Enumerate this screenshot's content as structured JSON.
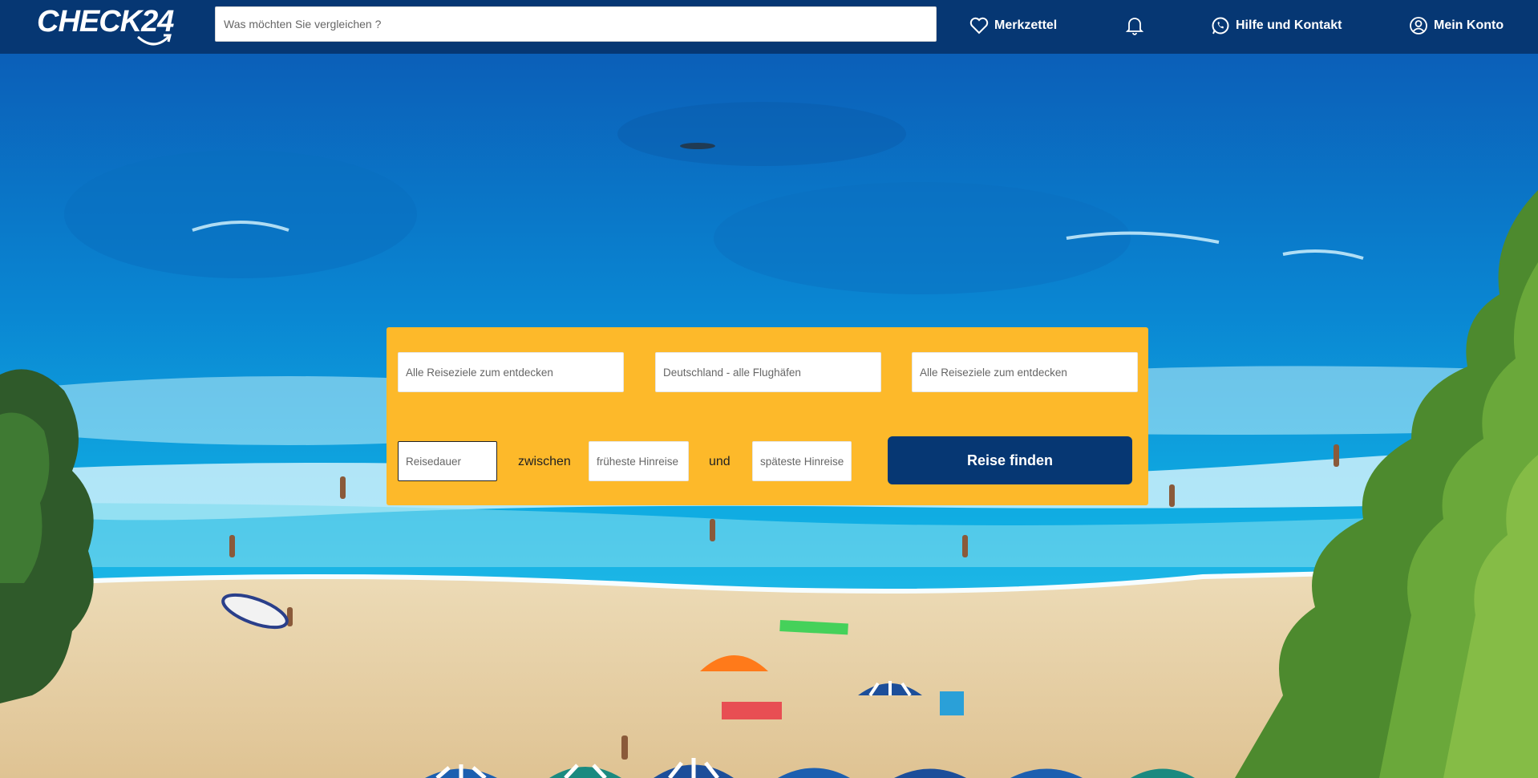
{
  "header": {
    "logo_text": "CHECK24",
    "search_placeholder": "Was möchten Sie vergleichen ?",
    "nav": {
      "wishlist_label": "Merkzettel",
      "help_label": "Hilfe und Kontakt",
      "account_label": "Mein Konto"
    }
  },
  "search_panel": {
    "destination_placeholder": "Alle Reiseziele zum entdecken",
    "airport_placeholder": "Deutschland - alle Flughäfen",
    "destination2_placeholder": "Alle Reiseziele zum entdecken",
    "duration_placeholder": "Reisedauer",
    "between_label": "zwischen",
    "earliest_placeholder": "früheste Hinreise",
    "and_label": "und",
    "latest_placeholder": "späteste Hinreise",
    "submit_label": "Reise finden"
  },
  "colors": {
    "header_bg": "#063773",
    "panel_bg": "#fdb92a",
    "button_bg": "#063773",
    "sea": "#0a9fd8",
    "sand": "#e6cfa4"
  },
  "icons": [
    "heart-icon",
    "bell-icon",
    "whatsapp-icon",
    "user-icon"
  ]
}
